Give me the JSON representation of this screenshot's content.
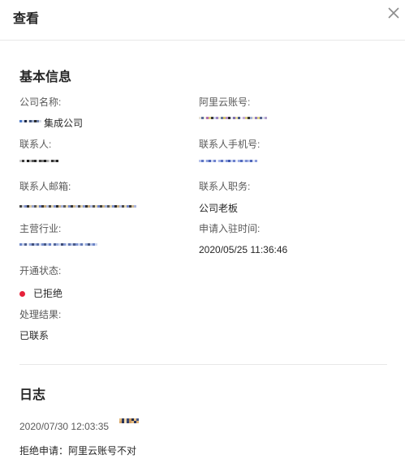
{
  "dialog": {
    "title": "查看",
    "close_icon": "close-icon"
  },
  "basic_info": {
    "title": "基本信息",
    "company_name_label": "公司名称:",
    "company_name_suffix": "集成公司",
    "aliyun_account_label": "阿里云账号:",
    "contact_label": "联系人:",
    "contact_phone_label": "联系人手机号:",
    "contact_email_label": "联系人邮箱:",
    "contact_position_label": "联系人职务:",
    "contact_position_value": "公司老板",
    "industry_label": "主营行业:",
    "apply_time_label": "申请入驻时间:",
    "apply_time_value": "2020/05/25 11:36:46",
    "status_label": "开通状态:",
    "status_value": "已拒绝",
    "status_color": "#e6223b",
    "result_label": "处理结果:",
    "result_value": "已联系"
  },
  "log": {
    "title": "日志",
    "entries": [
      {
        "time": "2020/07/30 12:03:35",
        "text": "拒绝申请：阿里云账号不对"
      }
    ]
  }
}
